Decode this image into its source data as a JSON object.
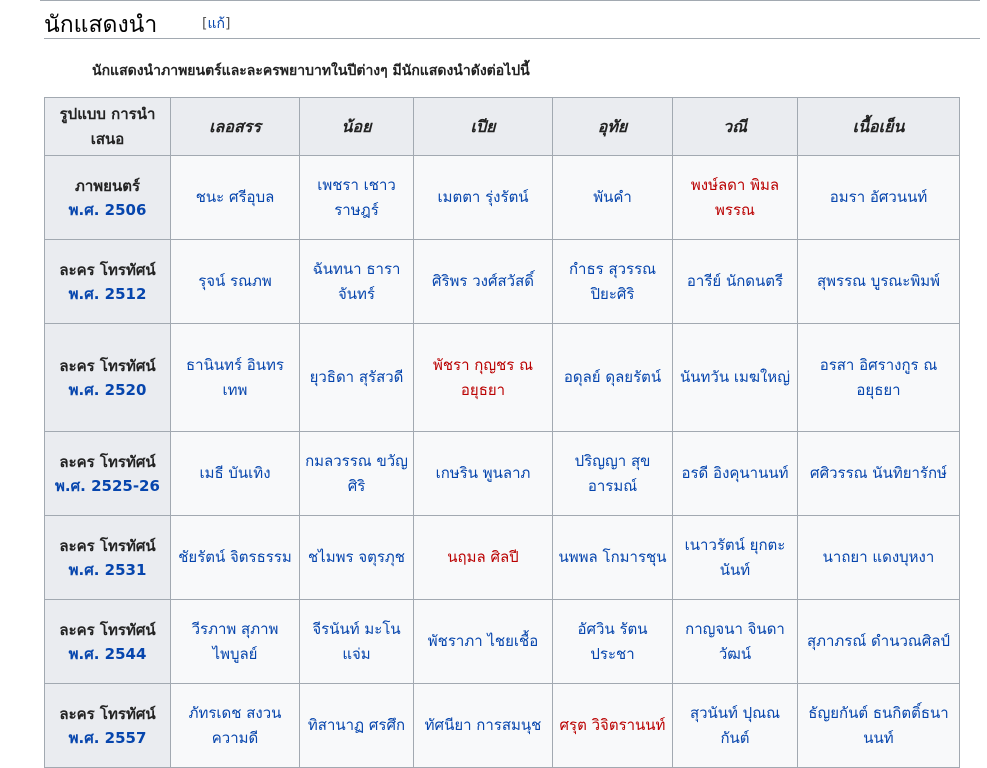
{
  "section": {
    "title": "นักแสดงนำ",
    "edit_open": "[",
    "edit_label": "แก้",
    "edit_close": "]"
  },
  "intro": "นักแสดงนำภาพยนตร์และละครพยาบาทในปีต่างๆ มีนักแสดงนำดังต่อไปนี้",
  "table": {
    "corner_header": "รูปแบบ การนำเสนอ",
    "characters": [
      "เลอสรร",
      "น้อย",
      "เปีย",
      "อุทัย",
      "วณี",
      "เนื้อเย็น"
    ],
    "rows": [
      {
        "format": "ภาพยนตร์",
        "year": "พ.ศ. 2506",
        "cast": [
          {
            "name": "ชนะ ศรีอุบล",
            "red": false
          },
          {
            "name": "เพชรา เชาวราษฎร์",
            "red": false
          },
          {
            "name": "เมตตา รุ่งรัตน์",
            "red": false
          },
          {
            "name": "พันคำ",
            "red": false
          },
          {
            "name": "พงษ์ลดา พิมลพรรณ",
            "red": true
          },
          {
            "name": "อมรา อัศวนนท์",
            "red": false
          }
        ]
      },
      {
        "format": "ละคร โทรทัศน์",
        "year": "พ.ศ. 2512",
        "cast": [
          {
            "name": "รุจน์ รณภพ",
            "red": false
          },
          {
            "name": "ฉันทนา ธาราจันทร์",
            "red": false
          },
          {
            "name": "ศิริพร วงศ์สวัสดิ์",
            "red": false
          },
          {
            "name": "กำธร สุวรรณปิยะศิริ",
            "red": false
          },
          {
            "name": "อารีย์ นักดนตรี",
            "red": false
          },
          {
            "name": "สุพรรณ บูรณะพิมพ์",
            "red": false
          }
        ]
      },
      {
        "format": "ละคร โทรทัศน์",
        "year": "พ.ศ. 2520",
        "cast": [
          {
            "name": "ธานินทร์ อินทรเทพ",
            "red": false
          },
          {
            "name": "ยุวธิดา สุรัสวดี",
            "red": false
          },
          {
            "name": "พัชรา กุญชร ณ อยุธยา",
            "red": true
          },
          {
            "name": "อดุลย์ ดุลยรัตน์",
            "red": false
          },
          {
            "name": "นันทวัน เมฆใหญ่",
            "red": false
          },
          {
            "name": "อรสา อิศรางกูร ณ อยุธยา",
            "red": false
          }
        ]
      },
      {
        "format": "ละคร โทรทัศน์",
        "year": "พ.ศ. 2525-26",
        "cast": [
          {
            "name": "เมธี บันเทิง",
            "red": false
          },
          {
            "name": "กมลวรรณ ขวัญศิริ",
            "red": false
          },
          {
            "name": "เกษริน พูนลาภ",
            "red": false
          },
          {
            "name": "ปริญญา สุขอารมณ์",
            "red": false
          },
          {
            "name": "อรดี อิงคุนานนท์",
            "red": false
          },
          {
            "name": "ศศิวรรณ นันทิยารักษ์",
            "red": false
          }
        ]
      },
      {
        "format": "ละคร โทรทัศน์",
        "year": "พ.ศ. 2531",
        "cast": [
          {
            "name": "ชัยรัตน์ จิตรธรรม",
            "red": false
          },
          {
            "name": "ชไมพร จตุรภุช",
            "red": false
          },
          {
            "name": "นฤมล ศิลปี",
            "red": true
          },
          {
            "name": "นพพล โกมารชุน",
            "red": false
          },
          {
            "name": "เนาวรัตน์ ยุกตะนันท์",
            "red": false
          },
          {
            "name": "นาถยา แดงบุหงา",
            "red": false
          }
        ]
      },
      {
        "format": "ละคร โทรทัศน์",
        "year": "พ.ศ. 2544",
        "cast": [
          {
            "name": "วีรภาพ สุภาพไพบูลย์",
            "red": false
          },
          {
            "name": "จีรนันท์ มะโนแจ่ม",
            "red": false
          },
          {
            "name": "พัชราภา ไชยเชื้อ",
            "red": false
          },
          {
            "name": "อัศวิน รัตนประชา",
            "red": false
          },
          {
            "name": "กาญจนา จินดาวัฒน์",
            "red": false
          },
          {
            "name": "สุภาภรณ์ ดำนวณศิลป์",
            "red": false
          }
        ]
      },
      {
        "format": "ละคร โทรทัศน์",
        "year": "พ.ศ. 2557",
        "cast": [
          {
            "name": "ภัทรเดช สงวนความดี",
            "red": false
          },
          {
            "name": "ทิสานาฏ ศรศึก",
            "red": false
          },
          {
            "name": "ทัศนียา การสมนุช",
            "red": false
          },
          {
            "name": "ศรุต วิจิตรานนท์",
            "red": true
          },
          {
            "name": "สุวนันท์ ปุณณกันต์",
            "red": false
          },
          {
            "name": "ธัญยกันต์ ธนกิตติ์ธนานนท์",
            "red": false
          }
        ]
      }
    ]
  },
  "colors": {
    "link": "#0645ad",
    "redlink": "#ba0000",
    "header_bg": "#eaecf0",
    "cell_bg": "#f8f9fa",
    "border": "#a2a9b1"
  }
}
